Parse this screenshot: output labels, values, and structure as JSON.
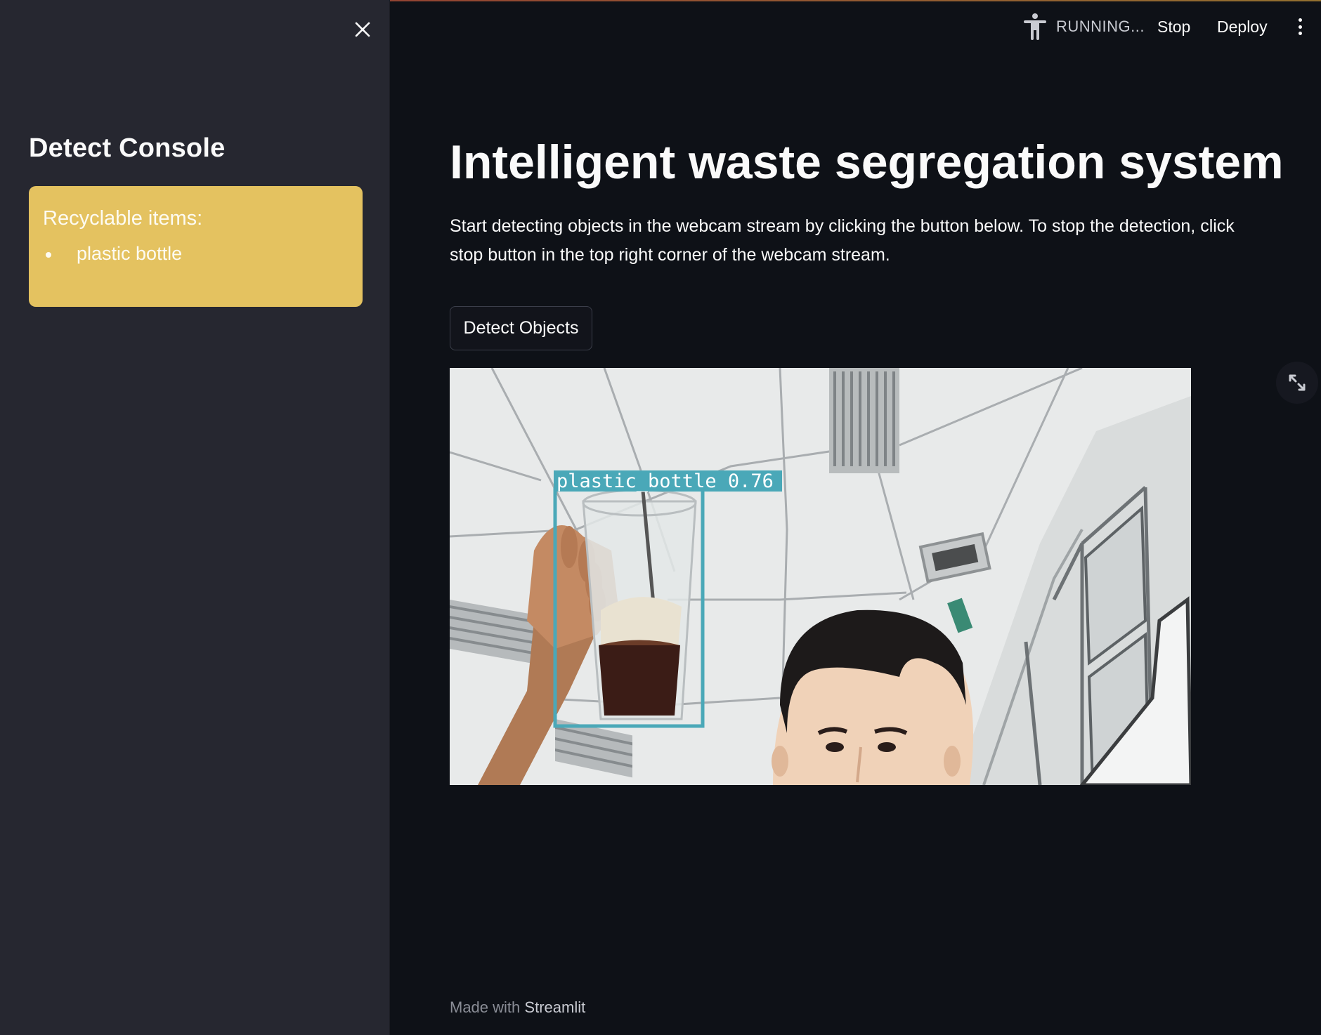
{
  "sidebar": {
    "title": "Detect Console",
    "alert": {
      "title": "Recyclable items:",
      "items": [
        "plastic bottle"
      ]
    }
  },
  "header": {
    "status": "RUNNING...",
    "stop_label": "Stop",
    "deploy_label": "Deploy"
  },
  "main": {
    "title": "Intelligent waste segregation system",
    "description": "Start detecting objects in the webcam stream by clicking the button below. To stop the detection, click stop button in the top right corner of the webcam stream.",
    "detect_button_label": "Detect Objects"
  },
  "detection": {
    "label": "plastic_bottle 0.76",
    "box_color": "#4aa8b8"
  },
  "footer": {
    "prefix": "Made with",
    "brand": "Streamlit"
  },
  "colors": {
    "alert_bg": "#e4c260",
    "sidebar_bg": "#262730",
    "app_bg": "#0e1117"
  }
}
